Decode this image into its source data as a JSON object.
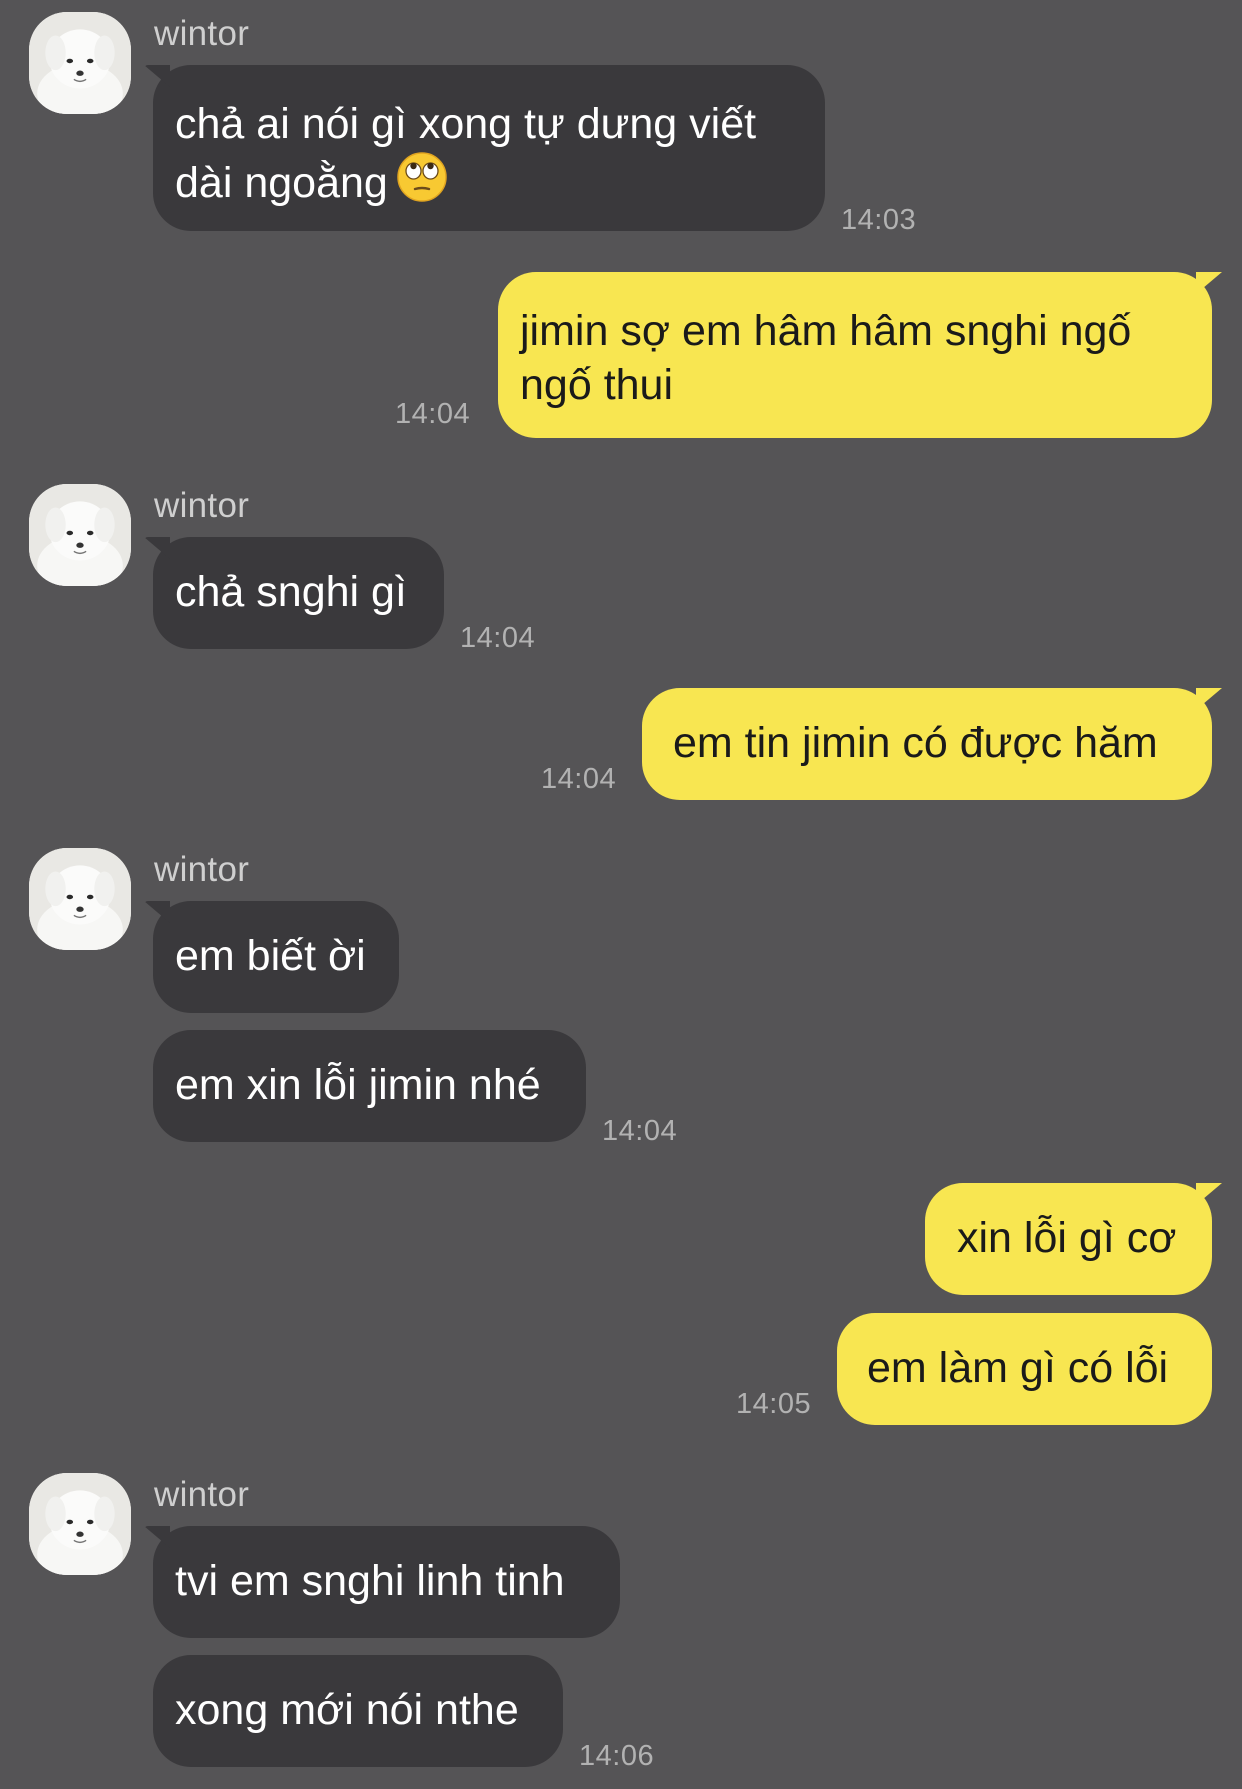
{
  "chat": {
    "sender_name": "wintor",
    "avatar_icon": "white-dog-avatar-icon",
    "messages": [
      {
        "direction": "in",
        "lines": [
          "chả ai nói gì xong tự dưng viết",
          "dài ngoằng"
        ],
        "emoji": "face-with-rolling-eyes-icon",
        "time": "14:03"
      },
      {
        "direction": "out",
        "lines": [
          "jimin sợ em hâm hâm snghi ngố",
          "ngố thui"
        ],
        "time": "14:04"
      },
      {
        "direction": "in",
        "text": "chả snghi gì",
        "time": "14:04"
      },
      {
        "direction": "out",
        "text": "em tin jimin có được hăm",
        "time": "14:04"
      },
      {
        "direction": "in",
        "text": "em biết ời"
      },
      {
        "direction": "in",
        "text": "em xin lỗi jimin nhé",
        "time": "14:04"
      },
      {
        "direction": "out",
        "text": "xin lỗi gì cơ"
      },
      {
        "direction": "out",
        "text": "em làm gì có lỗi",
        "time": "14:05"
      },
      {
        "direction": "in",
        "text": "tvi em snghi linh tinh"
      },
      {
        "direction": "in",
        "text": "xong mới nói nthe",
        "time": "14:06"
      }
    ]
  },
  "colors": {
    "background": "#555456",
    "incoming_bubble": "#3a393c",
    "outgoing_bubble": "#f8e651"
  }
}
